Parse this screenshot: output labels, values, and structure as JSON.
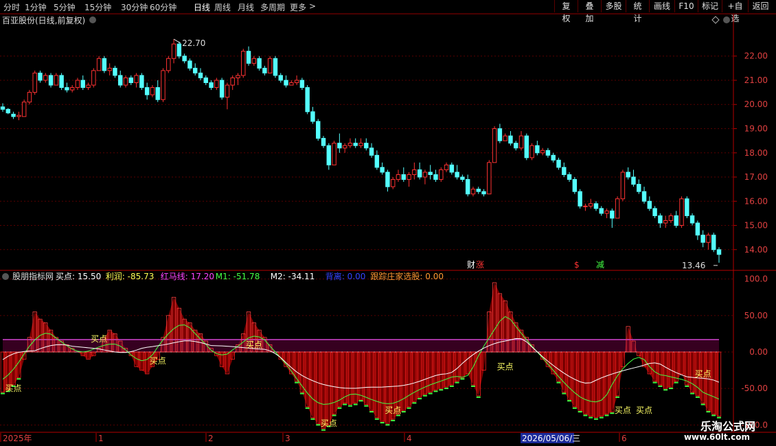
{
  "toolbar": {
    "periods": [
      "分时",
      "1分钟",
      "5分钟",
      "15分钟",
      "30分钟",
      "60分钟",
      "日线",
      "周线",
      "月线",
      "多周期",
      "更多"
    ],
    "active_period": "日线",
    "more_arrow": ">",
    "buttons": [
      "复权",
      "叠加",
      "多股",
      "统计",
      "画线",
      "F10",
      "标记",
      "+自选",
      "返回"
    ]
  },
  "main_panel": {
    "title": "百亚股份(日线,前复权)",
    "high_marker": "22.70",
    "low_marker": "13.46",
    "y_ticks": [
      "22.00",
      "21.00",
      "20.00",
      "19.00",
      "18.00",
      "17.00",
      "16.00",
      "15.00",
      "14.00"
    ],
    "event_labels": [
      "财",
      "涨",
      "$",
      "减"
    ]
  },
  "indicator_panel": {
    "name": "股朋指标网",
    "items": [
      {
        "label": "买点: 15.50",
        "color": "#ffffff"
      },
      {
        "label": "利润: -85.73",
        "color": "#ffff55"
      },
      {
        "label": "红马线: 17.20",
        "color": "#ff44ff"
      },
      {
        "label": "M1: -51.78",
        "color": "#44ff44"
      },
      {
        "label": "M2: -34.11",
        "color": "#ffffff"
      },
      {
        "label": "背离: 0.00",
        "color": "#3344ff"
      },
      {
        "label": "跟踪庄家选股: 0.00",
        "color": "#ff9933"
      }
    ],
    "y_ticks": [
      "100.0",
      "50.00",
      "0.00",
      "-50.00",
      "-100.0"
    ],
    "signal_label": "买点"
  },
  "time_axis": {
    "labels": [
      "2025年",
      "1",
      "2",
      "3",
      "4",
      "2026/05/06/三",
      "6"
    ]
  },
  "watermark": {
    "line1": "乐淘公式网",
    "line2": "www.60lt.com"
  },
  "colors": {
    "up": "#ff3232",
    "down": "#54ffff",
    "grid": "#5a0000",
    "axis": "#b40000",
    "fill": "#8b0000"
  },
  "chart_data": {
    "type": "candlestick",
    "price_range": [
      13.2,
      22.9
    ],
    "indicator_range": [
      -110,
      110
    ],
    "candles": [
      [
        19.9,
        20.05,
        19.7,
        19.8
      ],
      [
        19.8,
        19.85,
        19.6,
        19.65
      ],
      [
        19.6,
        19.7,
        19.4,
        19.5
      ],
      [
        19.5,
        19.7,
        19.35,
        19.55
      ],
      [
        19.5,
        20.2,
        19.5,
        20.1
      ],
      [
        20.1,
        20.6,
        20.0,
        20.5
      ],
      [
        20.5,
        21.4,
        20.4,
        21.3
      ],
      [
        21.3,
        21.4,
        20.9,
        21.0
      ],
      [
        21.0,
        21.3,
        20.9,
        21.2
      ],
      [
        21.2,
        21.3,
        20.7,
        20.8
      ],
      [
        20.8,
        21.3,
        20.8,
        21.2
      ],
      [
        21.2,
        21.3,
        20.6,
        20.7
      ],
      [
        20.7,
        20.9,
        20.5,
        20.6
      ],
      [
        20.6,
        20.8,
        20.5,
        20.7
      ],
      [
        20.7,
        21.1,
        20.6,
        21.0
      ],
      [
        21.0,
        21.2,
        20.6,
        20.7
      ],
      [
        20.7,
        20.9,
        20.6,
        20.8
      ],
      [
        20.8,
        21.5,
        20.7,
        21.4
      ],
      [
        21.4,
        22.0,
        21.4,
        21.9
      ],
      [
        21.9,
        22.0,
        21.3,
        21.4
      ],
      [
        21.4,
        21.7,
        21.2,
        21.5
      ],
      [
        21.5,
        21.6,
        21.1,
        21.2
      ],
      [
        21.2,
        21.4,
        20.7,
        20.8
      ],
      [
        20.8,
        21.2,
        20.7,
        21.1
      ],
      [
        21.1,
        21.2,
        20.8,
        20.9
      ],
      [
        20.9,
        21.3,
        20.7,
        21.2
      ],
      [
        21.2,
        21.3,
        20.6,
        20.7
      ],
      [
        20.7,
        20.9,
        20.2,
        20.4
      ],
      [
        20.4,
        20.8,
        20.3,
        20.7
      ],
      [
        20.7,
        21.0,
        20.1,
        20.2
      ],
      [
        20.2,
        21.5,
        20.1,
        21.4
      ],
      [
        21.4,
        22.0,
        21.3,
        21.9
      ],
      [
        21.9,
        22.7,
        21.7,
        22.5
      ],
      [
        22.5,
        22.6,
        21.9,
        22.0
      ],
      [
        22.0,
        22.1,
        21.7,
        21.8
      ],
      [
        21.8,
        21.9,
        21.4,
        21.5
      ],
      [
        21.5,
        21.7,
        21.2,
        21.3
      ],
      [
        21.3,
        21.5,
        21.0,
        21.1
      ],
      [
        21.1,
        21.2,
        20.8,
        20.9
      ],
      [
        20.9,
        21.0,
        20.6,
        20.7
      ],
      [
        20.7,
        21.1,
        20.6,
        21.0
      ],
      [
        21.0,
        21.1,
        20.2,
        20.3
      ],
      [
        20.3,
        20.9,
        19.8,
        20.8
      ],
      [
        20.8,
        21.2,
        20.6,
        21.1
      ],
      [
        21.1,
        21.3,
        20.8,
        21.2
      ],
      [
        21.2,
        22.3,
        21.1,
        22.2
      ],
      [
        22.2,
        22.4,
        21.6,
        21.7
      ],
      [
        21.7,
        22.0,
        21.6,
        21.9
      ],
      [
        21.9,
        22.0,
        21.4,
        21.5
      ],
      [
        21.5,
        21.6,
        21.2,
        21.3
      ],
      [
        21.3,
        22.0,
        21.3,
        21.9
      ],
      [
        21.9,
        22.0,
        21.1,
        21.2
      ],
      [
        21.2,
        21.3,
        20.9,
        21.0
      ],
      [
        21.0,
        21.2,
        20.7,
        20.8
      ],
      [
        20.8,
        21.0,
        20.8,
        20.9
      ],
      [
        20.9,
        21.2,
        20.8,
        21.0
      ],
      [
        21.0,
        21.1,
        20.6,
        20.7
      ],
      [
        20.7,
        20.8,
        19.6,
        19.7
      ],
      [
        19.7,
        19.9,
        19.2,
        19.3
      ],
      [
        19.3,
        19.4,
        18.5,
        18.6
      ],
      [
        18.6,
        18.7,
        18.2,
        18.3
      ],
      [
        18.3,
        18.4,
        17.3,
        17.5
      ],
      [
        17.5,
        18.5,
        17.5,
        18.4
      ],
      [
        18.4,
        18.8,
        18.0,
        18.2
      ],
      [
        18.2,
        18.4,
        18.0,
        18.3
      ],
      [
        18.3,
        18.6,
        18.2,
        18.4
      ],
      [
        18.4,
        18.6,
        18.2,
        18.3
      ],
      [
        18.3,
        18.6,
        18.2,
        18.4
      ],
      [
        18.4,
        18.6,
        18.1,
        18.2
      ],
      [
        18.2,
        18.4,
        17.8,
        17.9
      ],
      [
        17.9,
        18.1,
        17.3,
        17.4
      ],
      [
        17.4,
        17.6,
        17.1,
        17.2
      ],
      [
        17.2,
        17.3,
        16.4,
        16.6
      ],
      [
        16.6,
        17.0,
        16.5,
        16.9
      ],
      [
        16.9,
        17.3,
        16.8,
        17.1
      ],
      [
        17.1,
        17.4,
        16.8,
        16.9
      ],
      [
        16.9,
        17.2,
        16.6,
        17.1
      ],
      [
        17.1,
        17.6,
        16.9,
        17.3
      ],
      [
        17.3,
        17.6,
        16.9,
        17.0
      ],
      [
        17.0,
        17.3,
        16.7,
        17.2
      ],
      [
        17.2,
        17.5,
        16.9,
        17.1
      ],
      [
        17.1,
        17.3,
        16.8,
        16.9
      ],
      [
        16.9,
        17.4,
        16.8,
        17.3
      ],
      [
        17.3,
        17.6,
        17.2,
        17.5
      ],
      [
        17.5,
        17.6,
        17.1,
        17.2
      ],
      [
        17.2,
        17.5,
        16.9,
        17.0
      ],
      [
        17.0,
        17.1,
        16.8,
        16.9
      ],
      [
        16.9,
        17.1,
        16.2,
        16.3
      ],
      [
        16.3,
        16.6,
        16.2,
        16.5
      ],
      [
        16.5,
        16.6,
        16.3,
        16.4
      ],
      [
        16.4,
        16.5,
        16.2,
        16.3
      ],
      [
        16.3,
        17.7,
        16.3,
        17.6
      ],
      [
        17.6,
        19.1,
        17.6,
        19.0
      ],
      [
        19.0,
        19.2,
        18.4,
        18.5
      ],
      [
        18.5,
        18.8,
        18.5,
        18.7
      ],
      [
        18.7,
        18.9,
        18.3,
        18.4
      ],
      [
        18.4,
        18.5,
        18.1,
        18.2
      ],
      [
        18.2,
        18.9,
        18.1,
        18.7
      ],
      [
        18.7,
        18.8,
        17.7,
        17.8
      ],
      [
        17.8,
        18.4,
        17.7,
        18.3
      ],
      [
        18.3,
        18.5,
        17.9,
        18.0
      ],
      [
        18.0,
        18.2,
        17.9,
        18.1
      ],
      [
        18.1,
        18.2,
        17.8,
        17.9
      ],
      [
        17.9,
        18.0,
        17.6,
        17.7
      ],
      [
        17.7,
        17.8,
        17.3,
        17.4
      ],
      [
        17.4,
        17.6,
        17.0,
        17.1
      ],
      [
        17.1,
        17.2,
        16.8,
        16.9
      ],
      [
        16.9,
        17.0,
        16.3,
        16.4
      ],
      [
        16.4,
        16.5,
        15.7,
        15.8
      ],
      [
        15.8,
        15.9,
        15.6,
        15.8
      ],
      [
        15.8,
        16.1,
        15.7,
        15.9
      ],
      [
        15.9,
        16.0,
        15.6,
        15.7
      ],
      [
        15.7,
        15.8,
        15.4,
        15.5
      ],
      [
        15.5,
        15.7,
        15.3,
        15.6
      ],
      [
        15.6,
        15.7,
        14.9,
        15.3
      ],
      [
        15.3,
        16.2,
        15.3,
        16.1
      ],
      [
        16.1,
        17.3,
        16.0,
        17.2
      ],
      [
        17.2,
        17.4,
        16.9,
        17.0
      ],
      [
        17.0,
        17.3,
        16.6,
        16.7
      ],
      [
        16.7,
        16.9,
        16.3,
        16.4
      ],
      [
        16.4,
        16.6,
        15.9,
        16.0
      ],
      [
        16.0,
        16.2,
        15.6,
        15.7
      ],
      [
        15.7,
        15.8,
        15.3,
        15.4
      ],
      [
        15.4,
        15.5,
        14.9,
        15.1
      ],
      [
        15.1,
        15.4,
        14.9,
        15.2
      ],
      [
        15.2,
        15.5,
        15.1,
        15.4
      ],
      [
        15.4,
        15.6,
        14.9,
        15.0
      ],
      [
        15.0,
        16.2,
        14.9,
        16.1
      ],
      [
        16.1,
        16.2,
        15.3,
        15.4
      ],
      [
        15.4,
        15.5,
        15.0,
        15.1
      ],
      [
        15.1,
        15.2,
        14.4,
        14.6
      ],
      [
        14.6,
        14.8,
        14.1,
        14.3
      ],
      [
        14.3,
        14.7,
        14.0,
        14.6
      ],
      [
        14.6,
        14.7,
        13.9,
        14.0
      ],
      [
        14.0,
        14.1,
        13.46,
        13.8
      ]
    ],
    "indicator_base": [
      -55,
      -52,
      -45,
      -35,
      -10,
      20,
      55,
      45,
      40,
      30,
      20,
      15,
      10,
      5,
      0,
      -5,
      -10,
      -5,
      5,
      20,
      30,
      25,
      15,
      5,
      -5,
      -20,
      -25,
      -30,
      -20,
      -10,
      20,
      50,
      75,
      60,
      45,
      40,
      30,
      25,
      15,
      5,
      -5,
      -20,
      -30,
      -10,
      10,
      25,
      55,
      40,
      30,
      20,
      10,
      0,
      -10,
      -20,
      -30,
      -40,
      -55,
      -75,
      -90,
      -98,
      -105,
      -100,
      -85,
      -75,
      -70,
      -72,
      -70,
      -65,
      -72,
      -80,
      -90,
      -95,
      -98,
      -92,
      -85,
      -80,
      -75,
      -68,
      -62,
      -58,
      -55,
      -52,
      -50,
      -48,
      -45,
      -40,
      -35,
      -30,
      -45,
      -60,
      -25,
      55,
      95,
      80,
      70,
      55,
      40,
      30,
      20,
      10,
      0,
      -10,
      -20,
      -30,
      -40,
      -55,
      -65,
      -75,
      -80,
      -85,
      -88,
      -90,
      -88,
      -85,
      -82,
      -60,
      -20,
      35,
      15,
      -5,
      -20,
      -30,
      -40,
      -45,
      -50,
      -48,
      -40,
      -30,
      -45,
      -55,
      -60,
      -70,
      -80,
      -85,
      -88
    ]
  }
}
